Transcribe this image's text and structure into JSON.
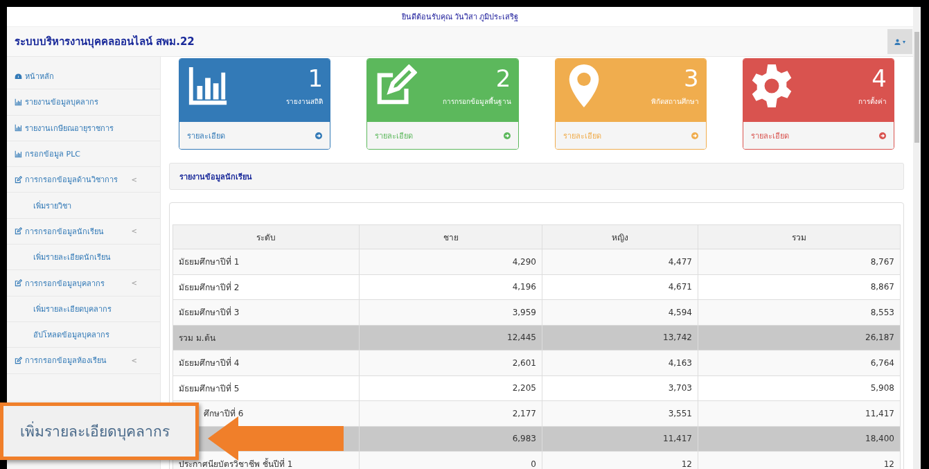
{
  "welcome": "ยินดีต้อนรับคุณ วันวิสา ภูมิประเสริฐ",
  "navbar": {
    "title": "ระบบบริหารงานบุคคลออนไลน์ สพม.22",
    "user_menu": {
      "caret": "▾"
    }
  },
  "sidebar": {
    "items": [
      {
        "kind": "dashboard",
        "label": "หน้าหลัก"
      },
      {
        "kind": "chart",
        "label": "รายงานข้อมูลบุคลากร"
      },
      {
        "kind": "chart",
        "label": "รายงานเกษียณอายุราชการ"
      },
      {
        "kind": "chart",
        "label": "กรอกข้อมูล PLC"
      },
      {
        "kind": "edit",
        "label": "การกรอกข้อมูลด้านวิชาการ",
        "caret": "<"
      },
      {
        "kind": "sub",
        "label": "เพิ่มรายวิชา"
      },
      {
        "kind": "edit",
        "label": "การกรอกข้อมูลนักเรียน",
        "caret": "<"
      },
      {
        "kind": "sub",
        "label": "เพิ่มรายละเอียดนักเรียน"
      },
      {
        "kind": "edit",
        "label": "การกรอกข้อมูลบุคลากร",
        "caret": "<"
      },
      {
        "kind": "sub",
        "label": "เพิ่มรายละเอียดบุคลากร"
      },
      {
        "kind": "sub",
        "label": "อัปโหลดข้อมูลบุคลากร"
      },
      {
        "kind": "edit",
        "label": "การกรอกข้อมูลห้องเรียน",
        "caret": "<"
      }
    ]
  },
  "cards": [
    {
      "kind": "chart",
      "color": "#337ab7",
      "number": "1",
      "label": "รายงานสถิติ",
      "footer": "รายละเอียด"
    },
    {
      "kind": "edit",
      "color": "#5cb85c",
      "number": "2",
      "label": "การกรอกข้อมูลพื้นฐาน",
      "footer": "รายละเอียด"
    },
    {
      "kind": "pin",
      "color": "#f0ad4e",
      "number": "3",
      "label": "พิกัดสถานศึกษา",
      "footer": "รายละเอียด"
    },
    {
      "kind": "gear",
      "color": "#d9534f",
      "number": "4",
      "label": "การตั้งค่า",
      "footer": "รายละเอียด"
    }
  ],
  "section_title": "รายงานข้อมูลนักเรียน",
  "table": {
    "columns": [
      "ระดับ",
      "ชาย",
      "หญิง",
      "รวม"
    ],
    "rows": [
      {
        "kind": "row",
        "cells": [
          "มัธยมศึกษาปีที่ 1",
          "4,290",
          "4,477",
          "8,767"
        ]
      },
      {
        "kind": "row",
        "cells": [
          "มัธยมศึกษาปีที่ 2",
          "4,196",
          "4,671",
          "8,867"
        ]
      },
      {
        "kind": "row",
        "cells": [
          "มัธยมศึกษาปีที่ 3",
          "3,959",
          "4,594",
          "8,553"
        ]
      },
      {
        "kind": "total",
        "cells": [
          "รวม ม.ต้น",
          "12,445",
          "13,742",
          "26,187"
        ]
      },
      {
        "kind": "row",
        "cells": [
          "มัธยมศึกษาปีที่ 4",
          "2,601",
          "4,163",
          "6,764"
        ]
      },
      {
        "kind": "row",
        "cells": [
          "มัธยมศึกษาปีที่ 5",
          "2,205",
          "3,703",
          "5,908"
        ]
      },
      {
        "kind": "row",
        "cells": [
          "ศึกษาปีที่ 6",
          "2,177",
          "3,551",
          "11,417"
        ]
      },
      {
        "kind": "total",
        "cells": [
          "",
          "6,983",
          "11,417",
          "18,400"
        ]
      },
      {
        "kind": "row",
        "cells": [
          "ประกาศนียบัตรวิชาชีพ ชั้นปีที่ 1",
          "0",
          "12",
          "12"
        ]
      }
    ]
  },
  "callout": {
    "text": "เพิ่มรายละเอียดบุคลากร"
  }
}
